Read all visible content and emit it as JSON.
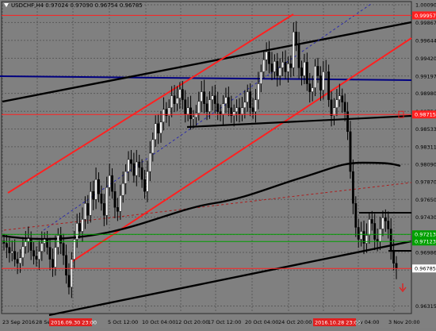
{
  "symbol_header": "USDCHF,H4  0.97024 0.97090 0.96754 0.96785",
  "colors": {
    "background": "#808080",
    "grid": "#5a5a5a",
    "bull": "#ffffff",
    "bear": "#000000",
    "channel": "#ff2020",
    "trend": "#000000",
    "horizontal_blue": "#000080",
    "level_red": "#ff2020",
    "level_green": "#00a000",
    "marker_red": "#e02020"
  },
  "chart_data": {
    "type": "candlestick",
    "timeframe": "H4",
    "ylim": [
      0.9622,
      1.0013
    ],
    "y_ticks": [
      "1.00090",
      "0.99867",
      "0.99644",
      "0.99420",
      "0.99197",
      "0.98980",
      "0.98754",
      "0.98533",
      "0.98311",
      "0.98090",
      "0.97870",
      "0.97650",
      "0.97430",
      "0.97210",
      "0.96986",
      "0.96765",
      "0.96315"
    ],
    "x_ticks": [
      "23 Sep 2016",
      "28 Se",
      "5 Oct 12:00",
      "10 Oct 04:00",
      "12 Oct 20:00",
      "17 Oct 12:00",
      "20 Oct 04:00",
      "24 Oct 20:00",
      "Nov 04:00",
      "3 Nov 20:00"
    ],
    "highlighted_time_labels": [
      "2016.09.30 23:00",
      "2016.10.28 23:00"
    ],
    "price_labels": [
      {
        "text": "0.99957",
        "value": 0.99957,
        "color": "#ff2020"
      },
      {
        "text": "0.98715",
        "value": 0.98715,
        "color": "#ff2020"
      },
      {
        "text": "0.97213",
        "value": 0.97213,
        "color": "#00a000"
      },
      {
        "text": "0.97123",
        "value": 0.97123,
        "color": "#00a000"
      },
      {
        "text": "0.96785",
        "value": 0.96785,
        "color": "#ffffff"
      }
    ],
    "close_series": [
      0.971,
      0.9705,
      0.9698,
      0.97,
      0.969,
      0.9685,
      0.9692,
      0.9706,
      0.9712,
      0.9716,
      0.9701,
      0.9694,
      0.969,
      0.97,
      0.971,
      0.9715,
      0.9705,
      0.969,
      0.968,
      0.9705,
      0.972,
      0.971,
      0.9695,
      0.967,
      0.9655,
      0.969,
      0.9715,
      0.9735,
      0.9725,
      0.974,
      0.976,
      0.9745,
      0.9775,
      0.9765,
      0.979,
      0.9772,
      0.976,
      0.9745,
      0.978,
      0.9795,
      0.9775,
      0.9755,
      0.975,
      0.977,
      0.9785,
      0.98,
      0.9815,
      0.981,
      0.9795,
      0.9812,
      0.9805,
      0.979,
      0.9775,
      0.98,
      0.9823,
      0.984,
      0.986,
      0.9848,
      0.9862,
      0.9878,
      0.987,
      0.988,
      0.9895,
      0.9885,
      0.9892,
      0.9903,
      0.989,
      0.9872,
      0.988,
      0.9866,
      0.9868,
      0.9873,
      0.9888,
      0.99,
      0.9885,
      0.9875,
      0.989,
      0.9895,
      0.9885,
      0.9875,
      0.9872,
      0.9885,
      0.9893,
      0.988,
      0.987,
      0.9875,
      0.988,
      0.9872,
      0.988,
      0.9887,
      0.99,
      0.988,
      0.9875,
      0.989,
      0.991,
      0.9925,
      0.994,
      0.995,
      0.9935,
      0.9925,
      0.9938,
      0.992,
      0.993,
      0.9937,
      0.9925,
      0.9935,
      0.993,
      0.9975,
      0.996,
      0.993,
      0.992,
      0.9937,
      0.991,
      0.99,
      0.9905,
      0.9932,
      0.992,
      0.9902,
      0.9925,
      0.9925,
      0.989,
      0.987,
      0.988,
      0.989,
      0.9895,
      0.9887,
      0.9875,
      0.985,
      0.98,
      0.976,
      0.973,
      0.9715,
      0.9725,
      0.971,
      0.972,
      0.974,
      0.9735,
      0.9715,
      0.9712,
      0.9728,
      0.9742,
      0.9738,
      0.9728,
      0.97,
      0.9685,
      0.96785
    ]
  }
}
